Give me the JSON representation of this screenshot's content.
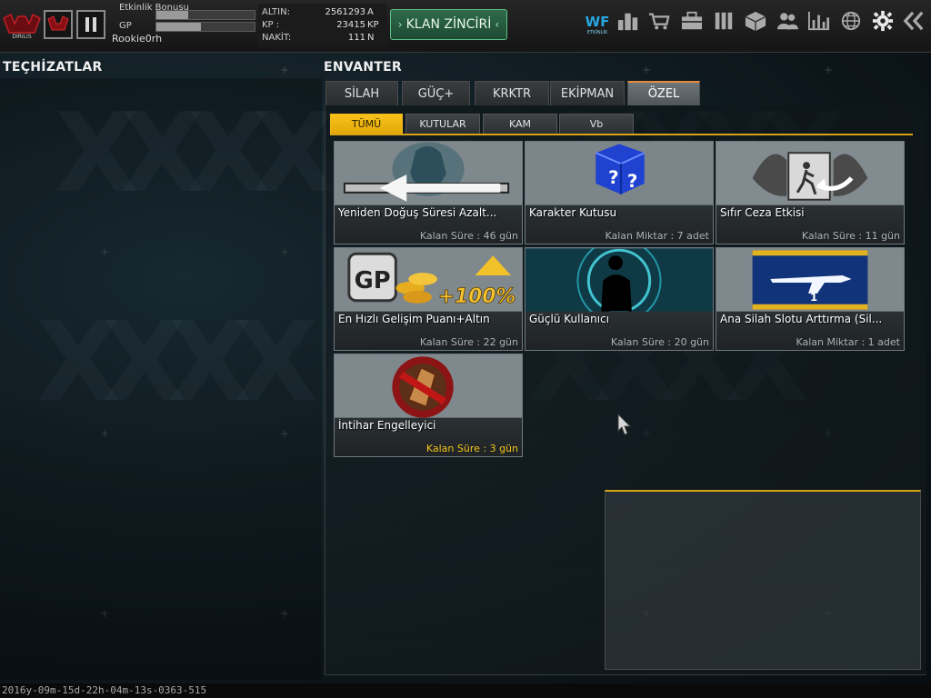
{
  "top_bar": {
    "event_bonus_label": "Etkinlik Bonusu",
    "event_bonus_progress": 0.32,
    "gp_label": "GP",
    "gp_progress": 0.45,
    "username": "Rookie0rh",
    "currency": [
      {
        "label": "ALTIN:",
        "value": "2561293",
        "unit": "A"
      },
      {
        "label": "KP :",
        "value": "23415",
        "unit": "KP"
      },
      {
        "label": "NAKİT:",
        "value": "111",
        "unit": "N"
      }
    ],
    "klan_button": "KLAN ZİNCİRİ",
    "icons": [
      "event-icon",
      "ranking-icon",
      "shop-cart-icon",
      "toolbox-icon",
      "equipment-icon",
      "box-icon",
      "friends-icon",
      "stats-icon",
      "globe-icon",
      "settings-gear-icon",
      "back-arrows-icon"
    ]
  },
  "left_panel": {
    "title": "TEÇHİZATLAR"
  },
  "inventory": {
    "title": "ENVANTER",
    "tabs": [
      "SİLAH",
      "GÜÇ+",
      "KRKTR",
      "EKİPMAN",
      "ÖZEL"
    ],
    "active_tab": "ÖZEL",
    "subtabs": [
      "TÜMÜ",
      "KUTULAR",
      "KAM",
      "Vb"
    ],
    "active_subtab": "TÜMÜ",
    "items": [
      {
        "name": "Yeniden Doğuş Süresi Azalt...",
        "info": "Kalan Süre : 46 gün",
        "highlight": false
      },
      {
        "name": "Karakter Kutusu",
        "info": "Kalan Miktar : 7 adet",
        "highlight": false
      },
      {
        "name": "Sıfır Ceza Etkisi",
        "info": "Kalan Süre : 11 gün",
        "highlight": false
      },
      {
        "name": "En Hızlı Gelişim Puanı+Altın",
        "info": "Kalan Süre : 22 gün",
        "highlight": false,
        "badge": "+100%"
      },
      {
        "name": "Güçlü Kullanıcı",
        "info": "Kalan Süre : 20 gün",
        "highlight": false
      },
      {
        "name": "Ana Silah Slotu Arttırma (Sil...",
        "info": "Kalan Miktar : 1 adet",
        "highlight": false
      },
      {
        "name": "İntihar Engelleyici",
        "info": "Kalan Süre : 3 gün",
        "highlight": true
      }
    ]
  },
  "status_bar": {
    "text": "2016y-09m-15d-22h-04m-13s-0363-515"
  }
}
